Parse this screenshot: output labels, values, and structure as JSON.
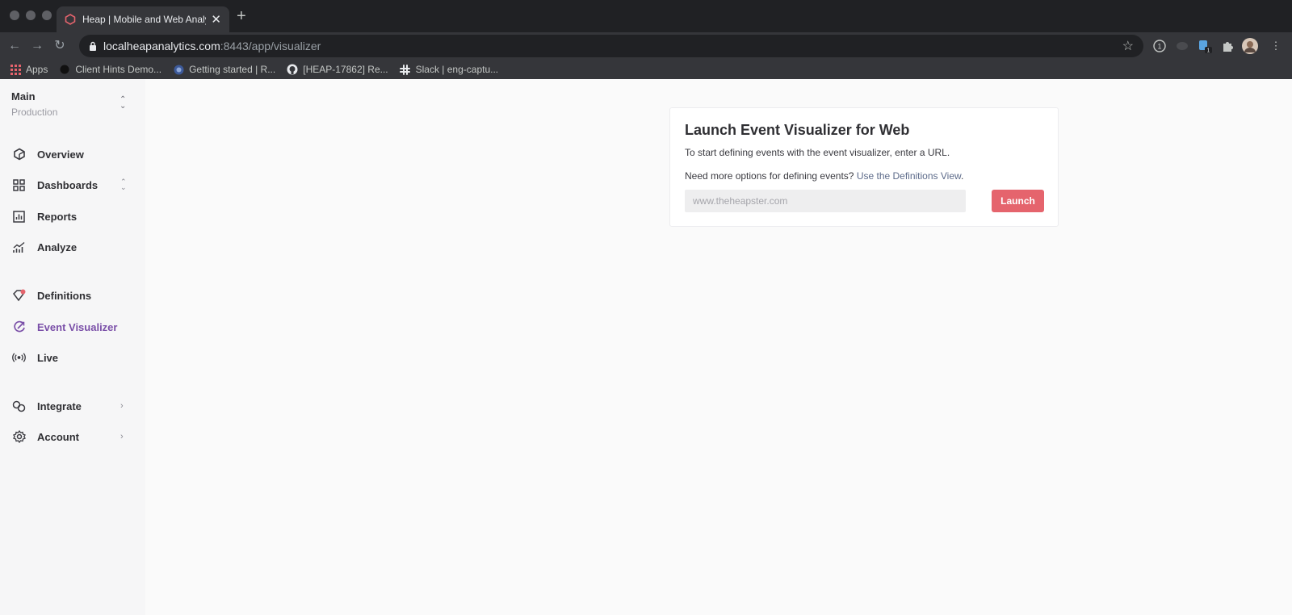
{
  "browser": {
    "tab_title": "Heap | Mobile and Web Analyti",
    "url_host": "localheapanalytics.com",
    "url_rest": ":8443/app/visualizer",
    "bookmarks": [
      {
        "label": "Apps",
        "icon": "apps-grid-icon"
      },
      {
        "label": "Client Hints Demo...",
        "icon": "circle-icon"
      },
      {
        "label": "Getting started | R...",
        "icon": "globe-icon"
      },
      {
        "label": "[HEAP-17862] Re...",
        "icon": "github-icon"
      },
      {
        "label": "Slack | eng-captu...",
        "icon": "slack-icon"
      }
    ],
    "extension_badge": "1"
  },
  "sidebar": {
    "env_name": "Main",
    "env_sub": "Production",
    "items": [
      {
        "label": "Overview",
        "icon": "overview-icon"
      },
      {
        "label": "Dashboards",
        "icon": "dashboards-icon"
      },
      {
        "label": "Reports",
        "icon": "reports-icon"
      },
      {
        "label": "Analyze",
        "icon": "analyze-icon"
      },
      {
        "label": "Definitions",
        "icon": "definitions-icon"
      },
      {
        "label": "Event Visualizer",
        "icon": "event-visualizer-icon",
        "active": true
      },
      {
        "label": "Live",
        "icon": "live-icon"
      },
      {
        "label": "Integrate",
        "icon": "integrate-icon"
      },
      {
        "label": "Account",
        "icon": "account-icon"
      }
    ]
  },
  "card": {
    "title": "Launch Event Visualizer for Web",
    "text1": "To start defining events with the event visualizer, enter a URL.",
    "text2_prefix": "Need more options for defining events?",
    "text2_link": "Use the Definitions View",
    "text2_suffix": ".",
    "input_placeholder": "www.theheapster.com",
    "button_label": "Launch"
  },
  "colors": {
    "accent": "#7a4fa8",
    "launch_button": "#e5646d",
    "notification_dot": "#e5646d"
  }
}
